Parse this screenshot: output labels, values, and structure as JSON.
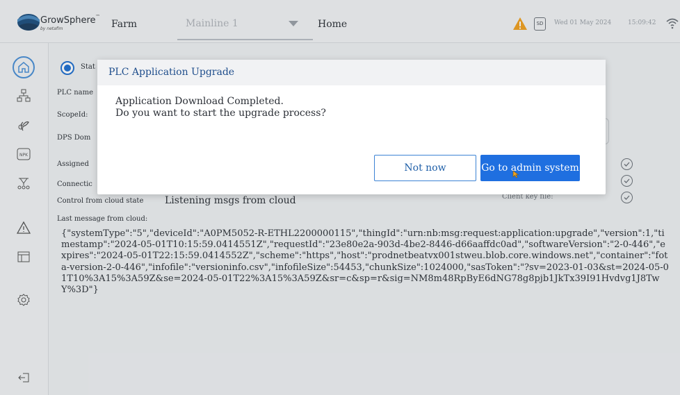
{
  "header": {
    "brand": "GrowSphere",
    "brand_tm": "™",
    "brand_sub": "by netafim",
    "farm_label": "Farm",
    "dropdown_value": "Mainline 1",
    "home_label": "Home",
    "sd_label": "SD",
    "date": "Wed 01 May 2024",
    "time": "15:09:42",
    "warning_color": "#f0a020"
  },
  "sidebar": {
    "items": [
      {
        "icon": "home-icon",
        "active": true
      },
      {
        "icon": "org-chart-icon"
      },
      {
        "icon": "plant-icon"
      },
      {
        "icon": "npk-icon",
        "label": "NPK"
      },
      {
        "icon": "network-icon"
      },
      {
        "icon": "alert-icon"
      },
      {
        "icon": "layout-icon"
      },
      {
        "icon": "settings-icon"
      },
      {
        "icon": "logout-icon"
      }
    ]
  },
  "main": {
    "status_label": "Stat",
    "labels": {
      "plc_name": "PLC name",
      "scope_id": "ScopeId:",
      "dps_domain": "DPS Dom",
      "assigned": "Assigned",
      "connection": "Connectic",
      "control_from_cloud": "Control from cloud state",
      "last_message": "Last message from cloud:",
      "client_key_file": "Client key file:"
    },
    "control_from_cloud_value": "Listening msgs from cloud",
    "last_message_value": "{\"systemType\":\"5\",\"deviceId\":\"A0PM5052-R-ETHL2200000115\",\"thingId\":\"urn:nb:msg:request:application:upgrade\",\"version\":1,\"timestamp\":\"2024-05-01T10:15:59.0414551Z\",\"requestId\":\"23e80e2a-903d-4be2-8446-d66aaffdc0ad\",\"softwareVersion\":\"2-0-446\",\"expires\":\"2024-05-01T22:15:59.0414552Z\",\"scheme\":\"https\",\"host\":\"prodnetbeatvx001stweu.blob.core.windows.net\",\"container\":\"fota-version-2-0-446\",\"infofile\":\"versioninfo.csv\",\"infofileSize\":54453,\"chunkSize\":1024000,\"sasToken\":\"?sv=2023-01-03&st=2024-05-01T10%3A15%3A59Z&se=2024-05-01T22%3A15%3A59Z&sr=c&sp=r&sig=NM8m48RpByE6dNG78g8pjb1JkTx39I91Hvdvg1J8TwY%3D\"}"
  },
  "dialog": {
    "title": "PLC Application Upgrade",
    "line1": "Application Download Completed.",
    "line2": "Do you want to start the upgrade process?",
    "not_now_label": "Not now",
    "go_admin_label": "Go to admin system",
    "primary_color": "#1f6fe0"
  }
}
